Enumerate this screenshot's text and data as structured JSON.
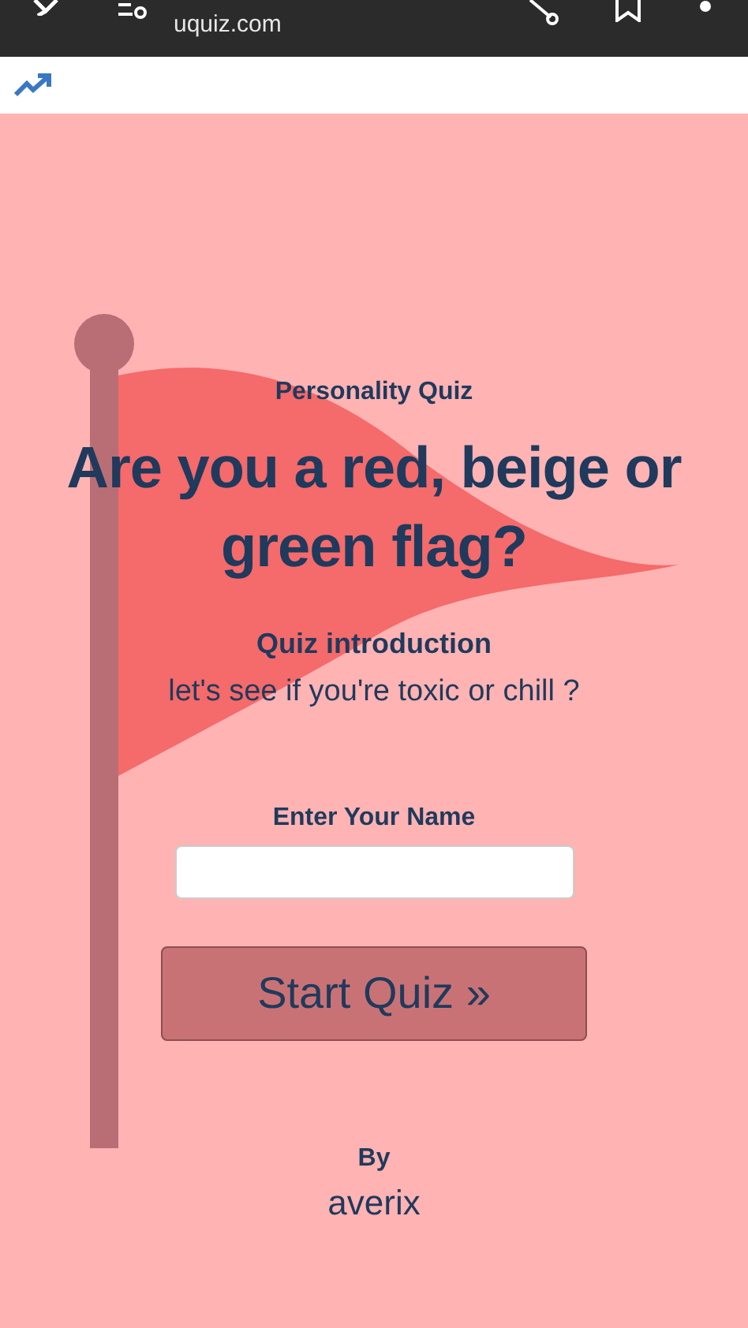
{
  "browser_bar": {
    "url": "uquiz.com"
  },
  "quiz": {
    "category": "Personality Quiz",
    "title": "Are you a red, beige or green flag?",
    "intro_heading": "Quiz introduction",
    "intro_text": "let's see if you're toxic or chill ?",
    "name_label": "Enter Your Name",
    "start_button": "Start Quiz »",
    "by_label": "By",
    "author": "averix"
  }
}
